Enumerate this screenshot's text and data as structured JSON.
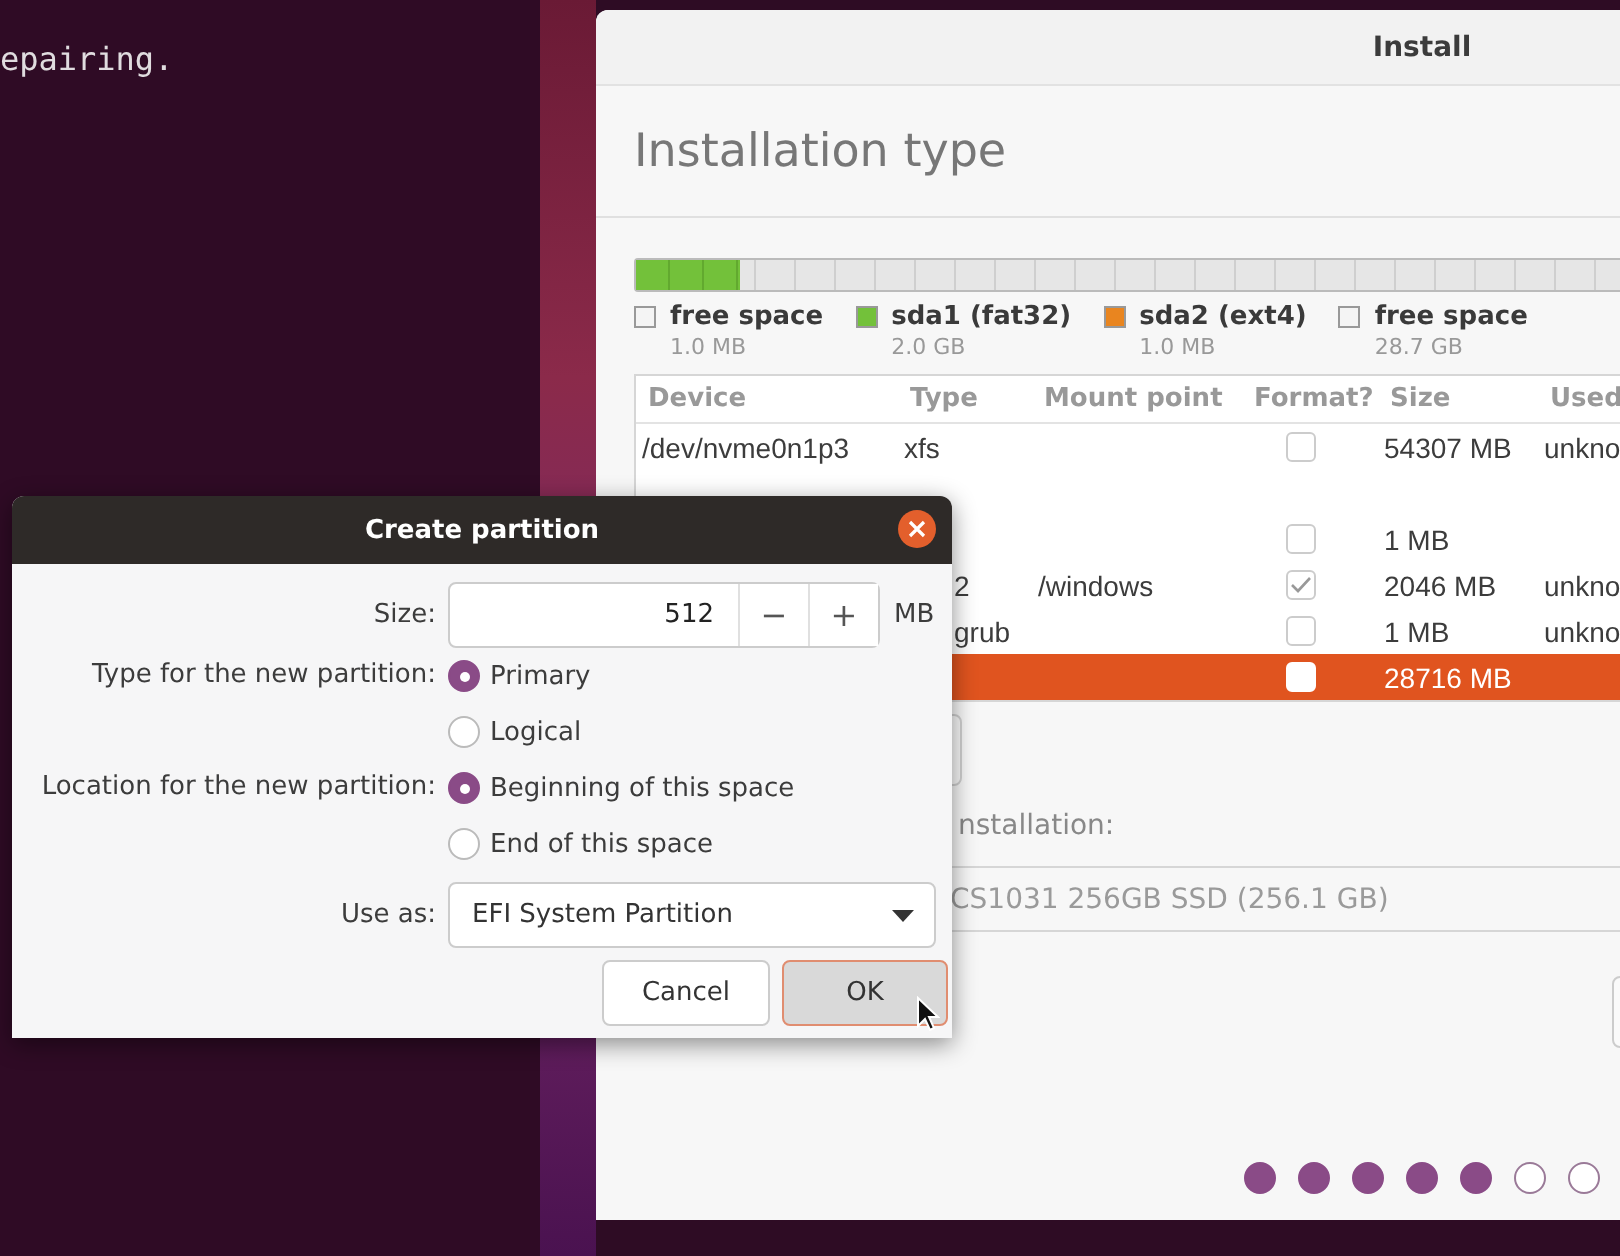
{
  "terminal": {
    "lines": [
      "epairing."
    ]
  },
  "installer": {
    "title": "Install",
    "heading": "Installation type",
    "disk_bar": {
      "level": 0.066
    },
    "legend": [
      {
        "name": "free space",
        "size": "1.0 MB",
        "color": "#f4f4f4"
      },
      {
        "name": "sda1 (fat32)",
        "size": "2.0 GB",
        "color": "#73c13a"
      },
      {
        "name": "sda2 (ext4)",
        "size": "1.0 MB",
        "color": "#e9851f"
      },
      {
        "name": "free space",
        "size": "28.7 GB",
        "color": "#f4f4f4"
      }
    ],
    "columns": [
      "Device",
      "Type",
      "Mount point",
      "Format?",
      "Size",
      "Used"
    ],
    "rows": [
      {
        "kind": "partition",
        "selected": false,
        "device": "/dev/nvme0n1p3",
        "type": "xfs",
        "format": false,
        "size": "54307 MB",
        "used": "unkno"
      },
      {
        "kind": "disk"
      },
      {
        "kind": "partition",
        "selected": false,
        "format": false,
        "size": "1 MB"
      },
      {
        "kind": "partition",
        "selected": false,
        "type": "2",
        "type_cut": true,
        "mount": "/windows",
        "format": true,
        "size": "2046 MB",
        "used": "unkno"
      },
      {
        "kind": "partition",
        "selected": false,
        "type": "grub",
        "type_cut": true,
        "format": false,
        "size": "1 MB",
        "used": "unkno"
      },
      {
        "kind": "partition",
        "selected": true,
        "format": false,
        "size": "28716 MB"
      }
    ],
    "boot_label": "nstallation:",
    "boot_device": "CS1031 256GB SSD (256.1 GB)",
    "steps": [
      {
        "done": true
      },
      {
        "done": true
      },
      {
        "done": true
      },
      {
        "done": true
      },
      {
        "done": true
      },
      {
        "done": false
      },
      {
        "done": false
      }
    ]
  },
  "dialog": {
    "title": "Create partition",
    "size_label": "Size:",
    "size_value": "512",
    "minus": "−",
    "plus": "+",
    "unit": "MB",
    "type_label": "Type for the new partition:",
    "type_options": [
      {
        "label": "Primary",
        "selected": true
      },
      {
        "label": "Logical",
        "selected": false
      }
    ],
    "location_label": "Location for the new partition:",
    "location_options": [
      {
        "label": "Beginning of this space",
        "selected": true
      },
      {
        "label": "End of this space",
        "selected": false
      }
    ],
    "use_label": "Use as:",
    "use_value": "EFI System Partition",
    "buttons": [
      {
        "label": "Cancel",
        "selected": false
      },
      {
        "label": "OK",
        "selected": true
      }
    ]
  }
}
